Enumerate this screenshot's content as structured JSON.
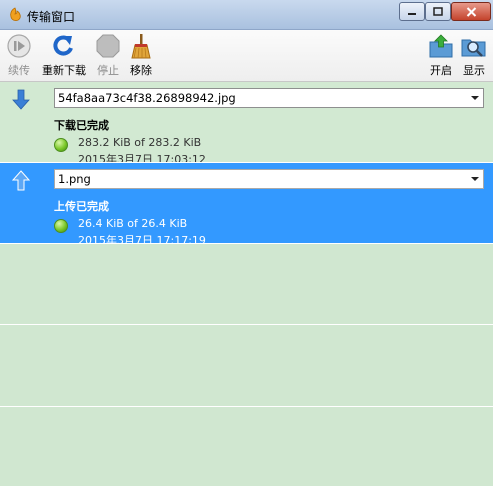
{
  "window": {
    "title": "传输窗口"
  },
  "toolbar": {
    "resume_label": "续传",
    "redownload_label": "重新下载",
    "stop_label": "停止",
    "remove_label": "移除",
    "open_label": "开启",
    "show_label": "显示"
  },
  "transfers": [
    {
      "direction": "download",
      "filename": "54fa8aa73c4f38.26898942.jpg",
      "status": "下载已完成",
      "size": "283.2 KiB of 283.2 KiB",
      "date": "2015年3月7日 17:03:12"
    },
    {
      "direction": "upload",
      "filename": "1.png",
      "status": "上传已完成",
      "size": "26.4 KiB of 26.4 KiB",
      "date": "2015年3月7日 17:17:19"
    }
  ],
  "colors": {
    "selection": "#3399ff",
    "row_background": "#d0e7d0",
    "download_arrow": "#3b7fd6"
  }
}
